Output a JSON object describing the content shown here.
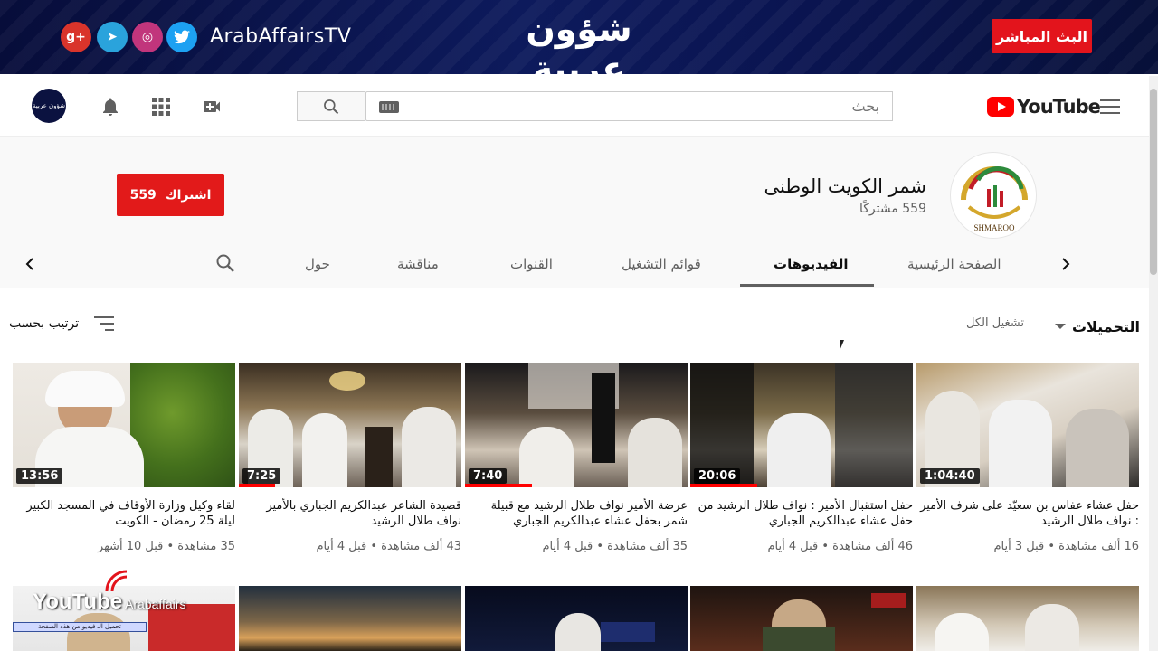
{
  "banner": {
    "handle": "ArabAffairsTV",
    "logo": "شؤون عربية",
    "live_label": "البث المباشر",
    "social": [
      {
        "icon": "google-plus-icon",
        "glyph": "g+",
        "color": "#d9342b"
      },
      {
        "icon": "telegram-icon",
        "glyph": "➤",
        "color": "#2aa3dc"
      },
      {
        "icon": "instagram-icon",
        "glyph": "◎",
        "color": "#c1357c"
      },
      {
        "icon": "twitter-icon",
        "glyph": "🐦",
        "color": "#1da1f2"
      }
    ]
  },
  "header": {
    "brand": "YouTube",
    "search_placeholder": "بحث",
    "avatar_label": "شؤون عربية"
  },
  "channel": {
    "name": "شمر الكويت الوطنى",
    "subscribers": "559 مشتركًا",
    "logo_caption": "SHMAROO",
    "subscribe_label": "اشتراك",
    "subscribe_count": "559",
    "tabs": [
      {
        "label": "الصفحة الرئيسية",
        "active": false
      },
      {
        "label": "الفيديوهات",
        "active": true
      },
      {
        "label": "قوائم التشغيل",
        "active": false
      },
      {
        "label": "القنوات",
        "active": false
      },
      {
        "label": "مناقشة",
        "active": false
      },
      {
        "label": "حول",
        "active": false
      }
    ]
  },
  "toolbar": {
    "uploads": "التحميلات",
    "play_all": "تشغيل الكل",
    "sort": "ترتيب بحسب"
  },
  "videos": [
    {
      "title": "حفل عشاء عفاس بن سعيّد على شرف الأمير : نواف طلال الرشيد",
      "meta": "16 ألف مشاهدة • قبل 3 أيام",
      "duration": "1:04:40",
      "progress": 0
    },
    {
      "title": "حفل استقبال الأمير : نواف طلال الرشيد من حفل عشاء عبدالكريم الجباري",
      "meta": "46 ألف مشاهدة • قبل 4 أيام",
      "duration": "20:06",
      "progress": 0.3
    },
    {
      "title": "عرضة الأمير نواف طلال الرشيد مع قبيلة شمر بحفل عشاء عبدالكريم الجباري",
      "meta": "35 ألف مشاهدة • قبل 4 أيام",
      "duration": "7:40",
      "progress": 0.3
    },
    {
      "title": "قصيدة الشاعر عبدالكريم الجباري بالأمير نواف طلال الرشيد",
      "meta": "43 ألف مشاهدة • قبل 4 أيام",
      "duration": "7:25",
      "progress": 0.16
    },
    {
      "title": "لقاء وكيل وزارة الأوقاف في المسجد الكبير ليلة 25 رمضان - الكويت",
      "meta": "35 مشاهدة • قبل 10 أشهر",
      "duration": "13:56",
      "progress": 0
    }
  ],
  "watermark": {
    "brand": "YouTube",
    "sub": "Arabaffairs",
    "bar_text": "تحميل الـ فيديو من هذه الصفحة"
  }
}
